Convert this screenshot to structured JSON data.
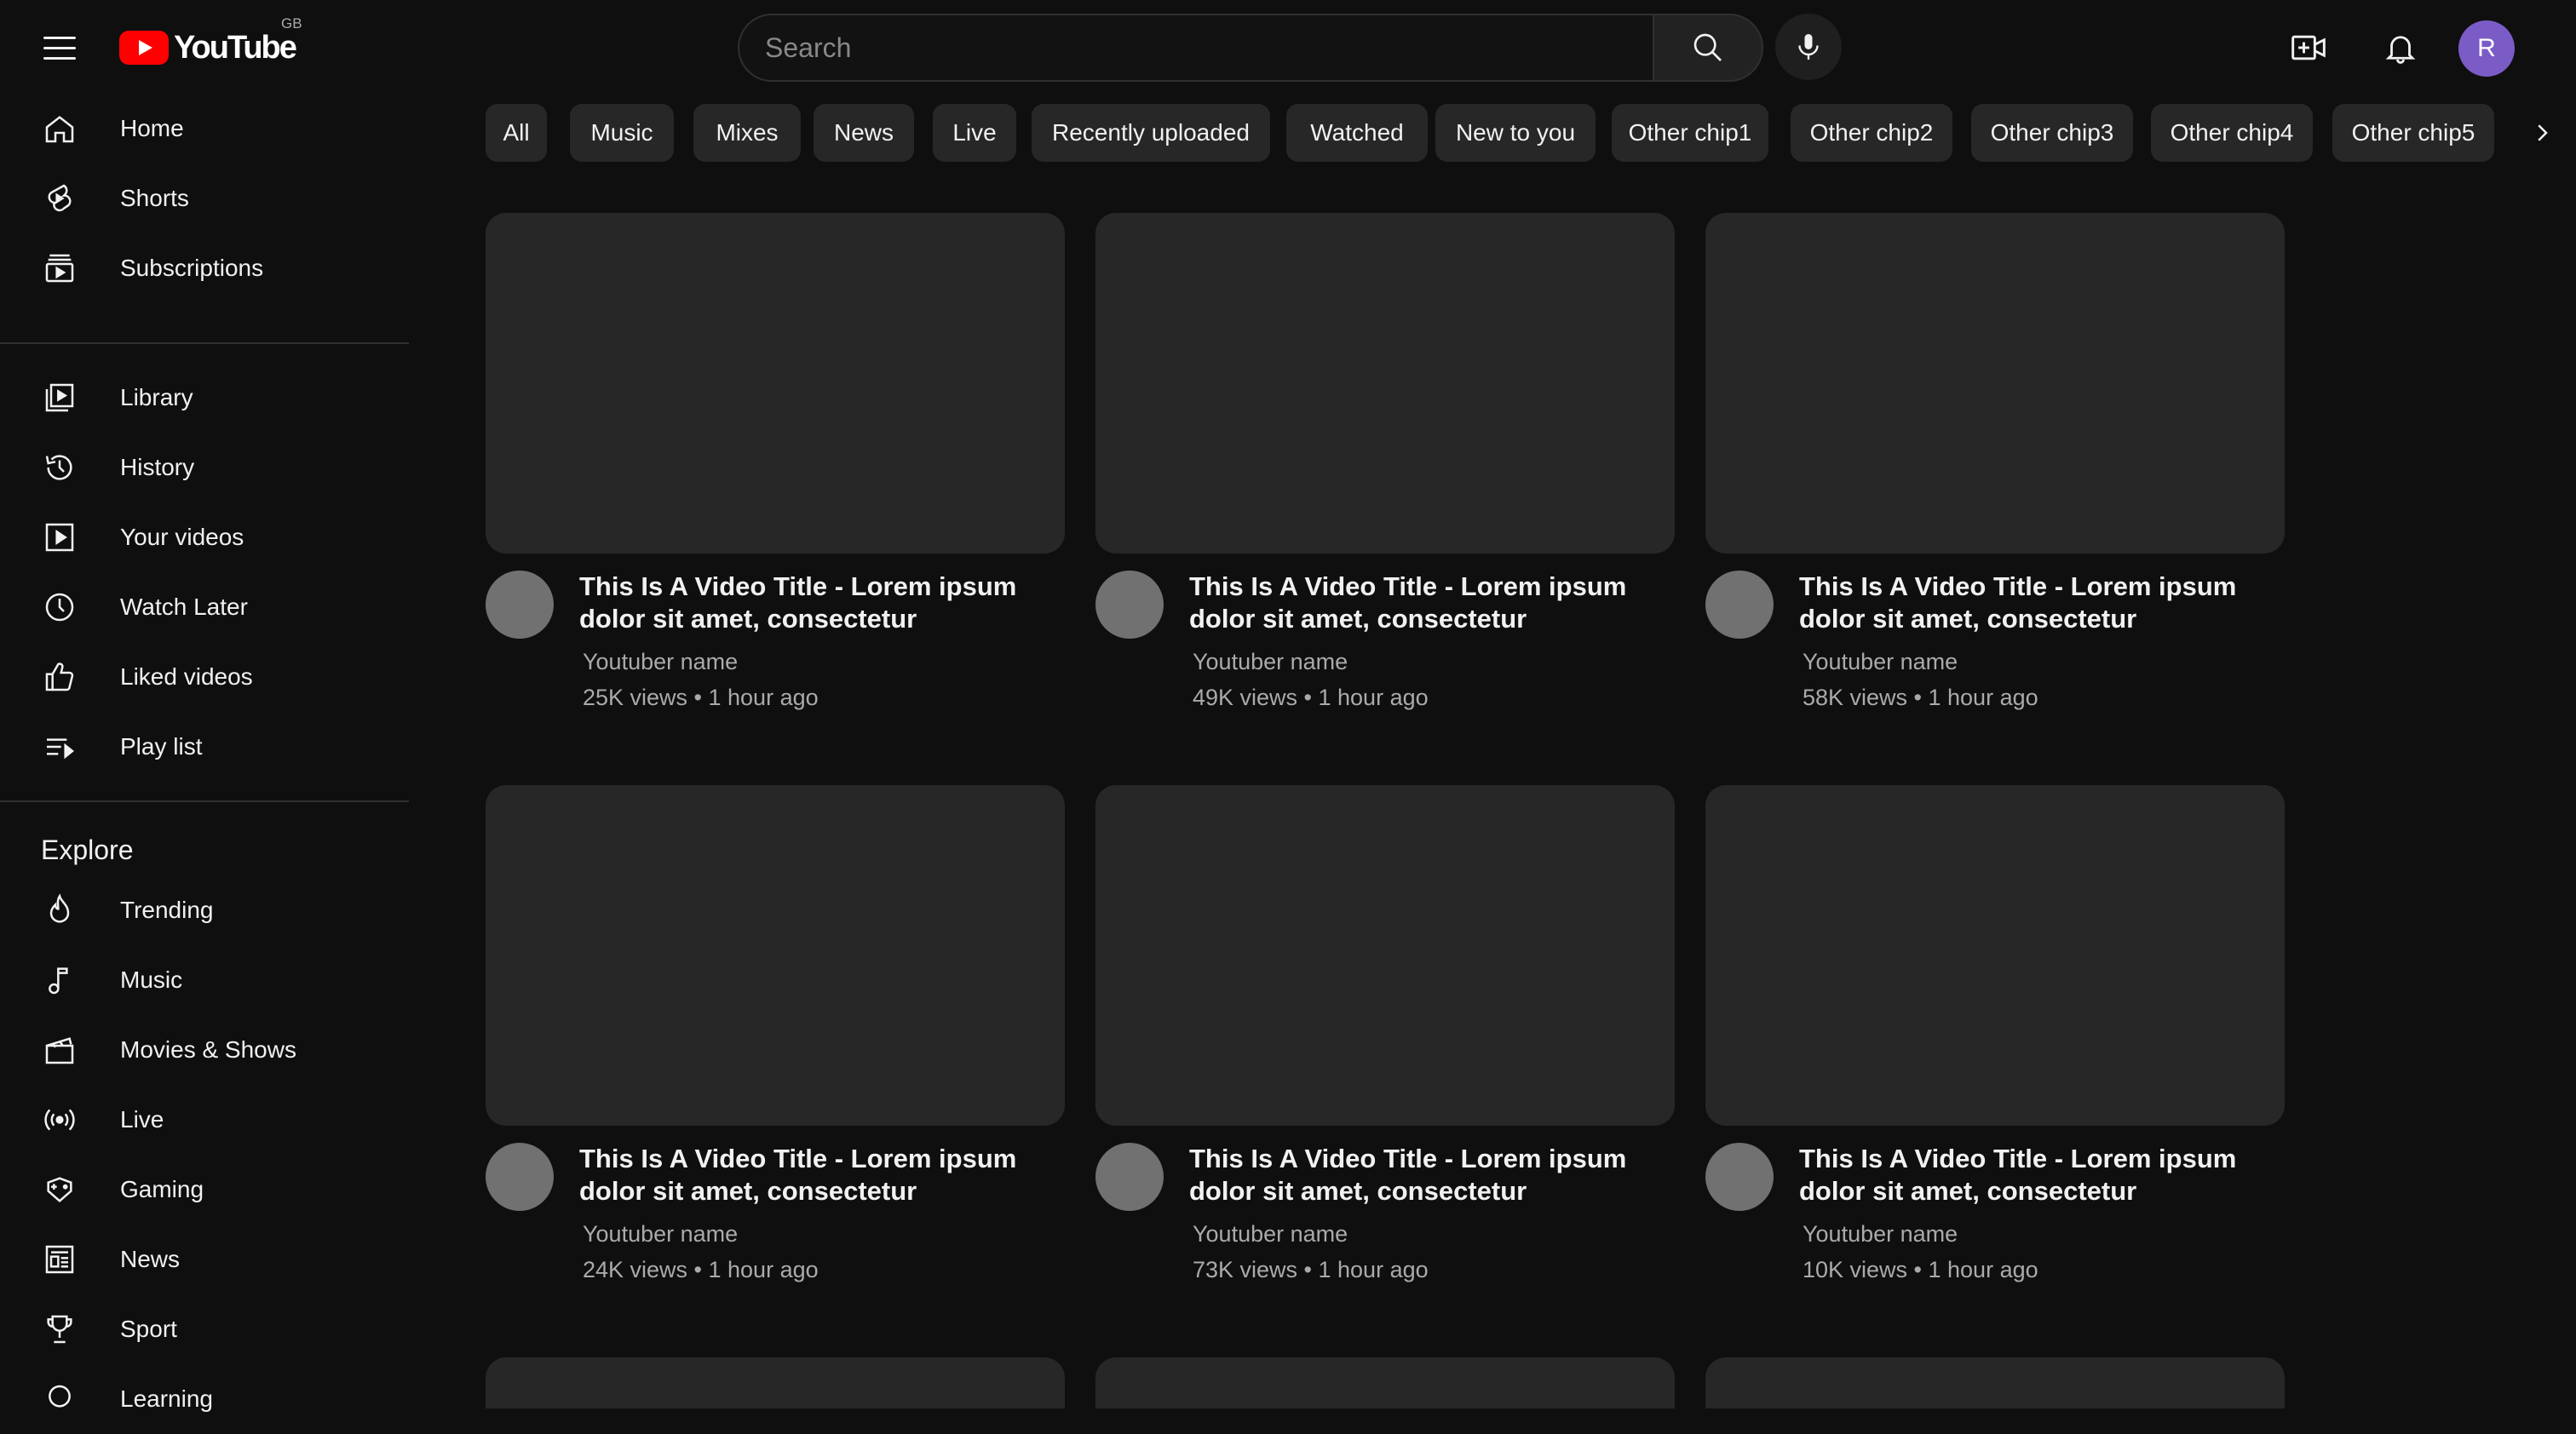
{
  "header": {
    "logo_text": "YouTube",
    "country_code": "GB",
    "search_placeholder": "Search",
    "avatar_letter": "R"
  },
  "sidebar": {
    "main": [
      {
        "label": "Home",
        "icon": "home-icon"
      },
      {
        "label": "Shorts",
        "icon": "shorts-icon"
      },
      {
        "label": "Subscriptions",
        "icon": "subscriptions-icon"
      }
    ],
    "library": [
      {
        "label": "Library",
        "icon": "library-icon"
      },
      {
        "label": "History",
        "icon": "history-icon"
      },
      {
        "label": "Your videos",
        "icon": "your-videos-icon"
      },
      {
        "label": "Watch Later",
        "icon": "watch-later-icon"
      },
      {
        "label": "Liked videos",
        "icon": "liked-videos-icon"
      },
      {
        "label": "Play list",
        "icon": "playlist-icon"
      }
    ],
    "explore_title": "Explore",
    "explore": [
      {
        "label": "Trending",
        "icon": "trending-icon"
      },
      {
        "label": "Music",
        "icon": "music-icon"
      },
      {
        "label": "Movies & Shows",
        "icon": "movies-icon"
      },
      {
        "label": "Live",
        "icon": "live-icon"
      },
      {
        "label": "Gaming",
        "icon": "gaming-icon"
      },
      {
        "label": "News",
        "icon": "news-icon"
      },
      {
        "label": "Sport",
        "icon": "sport-icon"
      },
      {
        "label": "Learning",
        "icon": "learning-icon"
      }
    ]
  },
  "chips": [
    "All",
    "Music",
    "Mixes",
    "News",
    "Live",
    "Recently uploaded",
    "Watched",
    "New to you",
    "Other chip1",
    "Other chip2",
    "Other chip3",
    "Other chip4",
    "Other chip5"
  ],
  "videos": [
    {
      "title": "This Is A Video Title - Lorem ipsum dolor sit amet, consectetur",
      "channel": "Youtuber name",
      "meta": "25K views • 1 hour ago"
    },
    {
      "title": "This Is A Video Title - Lorem ipsum dolor sit amet, consectetur",
      "channel": "Youtuber name",
      "meta": "49K views • 1 hour ago"
    },
    {
      "title": "This Is A Video Title - Lorem ipsum dolor sit amet, consectetur",
      "channel": "Youtuber name",
      "meta": "58K views • 1 hour ago"
    },
    {
      "title": "This Is A Video Title - Lorem ipsum dolor sit amet, consectetur",
      "channel": "Youtuber name",
      "meta": "24K views • 1 hour ago"
    },
    {
      "title": "This Is A Video Title - Lorem ipsum dolor sit amet, consectetur",
      "channel": "Youtuber name",
      "meta": "73K views • 1 hour ago"
    },
    {
      "title": "This Is A Video Title - Lorem ipsum dolor sit amet, consectetur",
      "channel": "Youtuber name",
      "meta": "10K views • 1 hour ago"
    }
  ],
  "colors": {
    "background": "#0f0f0f",
    "surface": "#272727",
    "brand_red": "#ff0000",
    "avatar": "#7b5cc6",
    "secondary_text": "#aaaaaa"
  }
}
